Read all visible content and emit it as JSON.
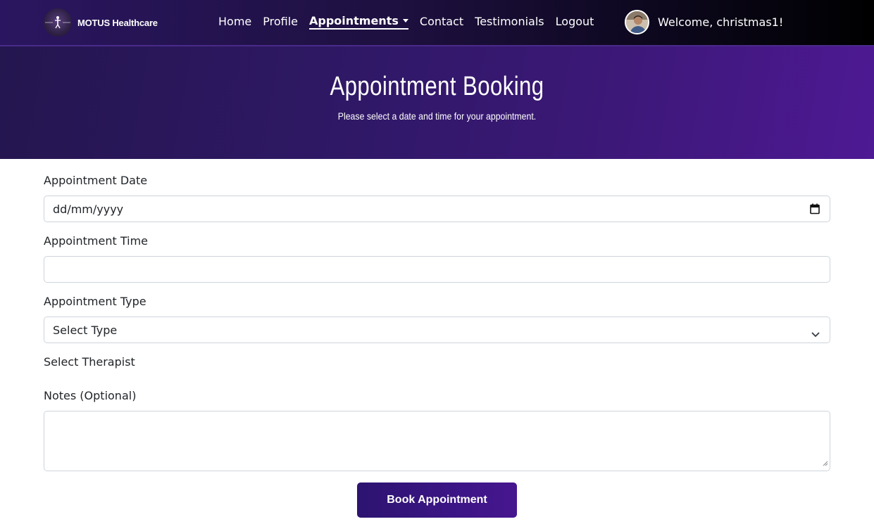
{
  "navbar": {
    "brand_name": "MOTUS Healthcare",
    "brand_logo_icon": "physio-figure-logo-icon",
    "links": [
      {
        "label": "Home"
      },
      {
        "label": "Profile"
      },
      {
        "label": "Appointments",
        "active": true,
        "has_dropdown": true
      },
      {
        "label": "Contact"
      },
      {
        "label": "Testimonials"
      },
      {
        "label": "Logout"
      }
    ],
    "welcome_text": "Welcome, christmas1!"
  },
  "hero": {
    "title": "Appointment Booking",
    "subtitle": "Please select a date and time for your appointment."
  },
  "form": {
    "date_label": "Appointment Date",
    "date_value": "dd/mm/yyyy",
    "date_icon": "calendar-icon",
    "time_label": "Appointment Time",
    "time_value": "",
    "type_label": "Appointment Type",
    "type_selected": "Select Type",
    "type_icon": "chevron-down-icon",
    "therapist_label": "Select Therapist",
    "notes_label": "Notes (Optional)",
    "notes_value": "",
    "submit_label": "Book Appointment"
  },
  "colors": {
    "navbar_gradient_start": "#2a1660",
    "navbar_gradient_end": "#000000",
    "hero_gradient_start": "#24164f",
    "hero_gradient_end": "#4e1994",
    "button_color": "#3b1585",
    "input_border": "#ced4da"
  }
}
